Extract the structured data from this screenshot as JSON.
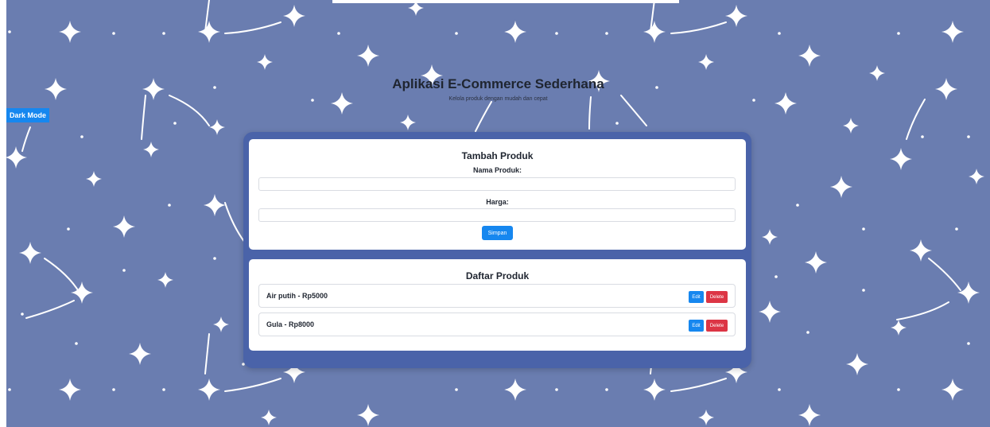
{
  "app": {
    "title": "Aplikasi E-Commerce Sederhana",
    "subtitle": "Kelola produk dengan mudah dan cepat"
  },
  "theme_toggle": {
    "label": "Dark Mode"
  },
  "form": {
    "heading": "Tambah Produk",
    "name_label": "Nama Produk:",
    "name_value": "",
    "price_label": "Harga:",
    "price_value": "",
    "submit_label": "Simpan"
  },
  "list": {
    "heading": "Daftar Produk",
    "items": [
      {
        "text": "Air putih - Rp5000",
        "edit_label": "Edit",
        "delete_label": "Delete"
      },
      {
        "text": "Gula - Rp8000",
        "edit_label": "Edit",
        "delete_label": "Delete"
      }
    ]
  },
  "colors": {
    "background": "#6a7db0",
    "container": "#4a63a9",
    "primary_button": "#1687ef",
    "danger_button": "#dc3545"
  }
}
